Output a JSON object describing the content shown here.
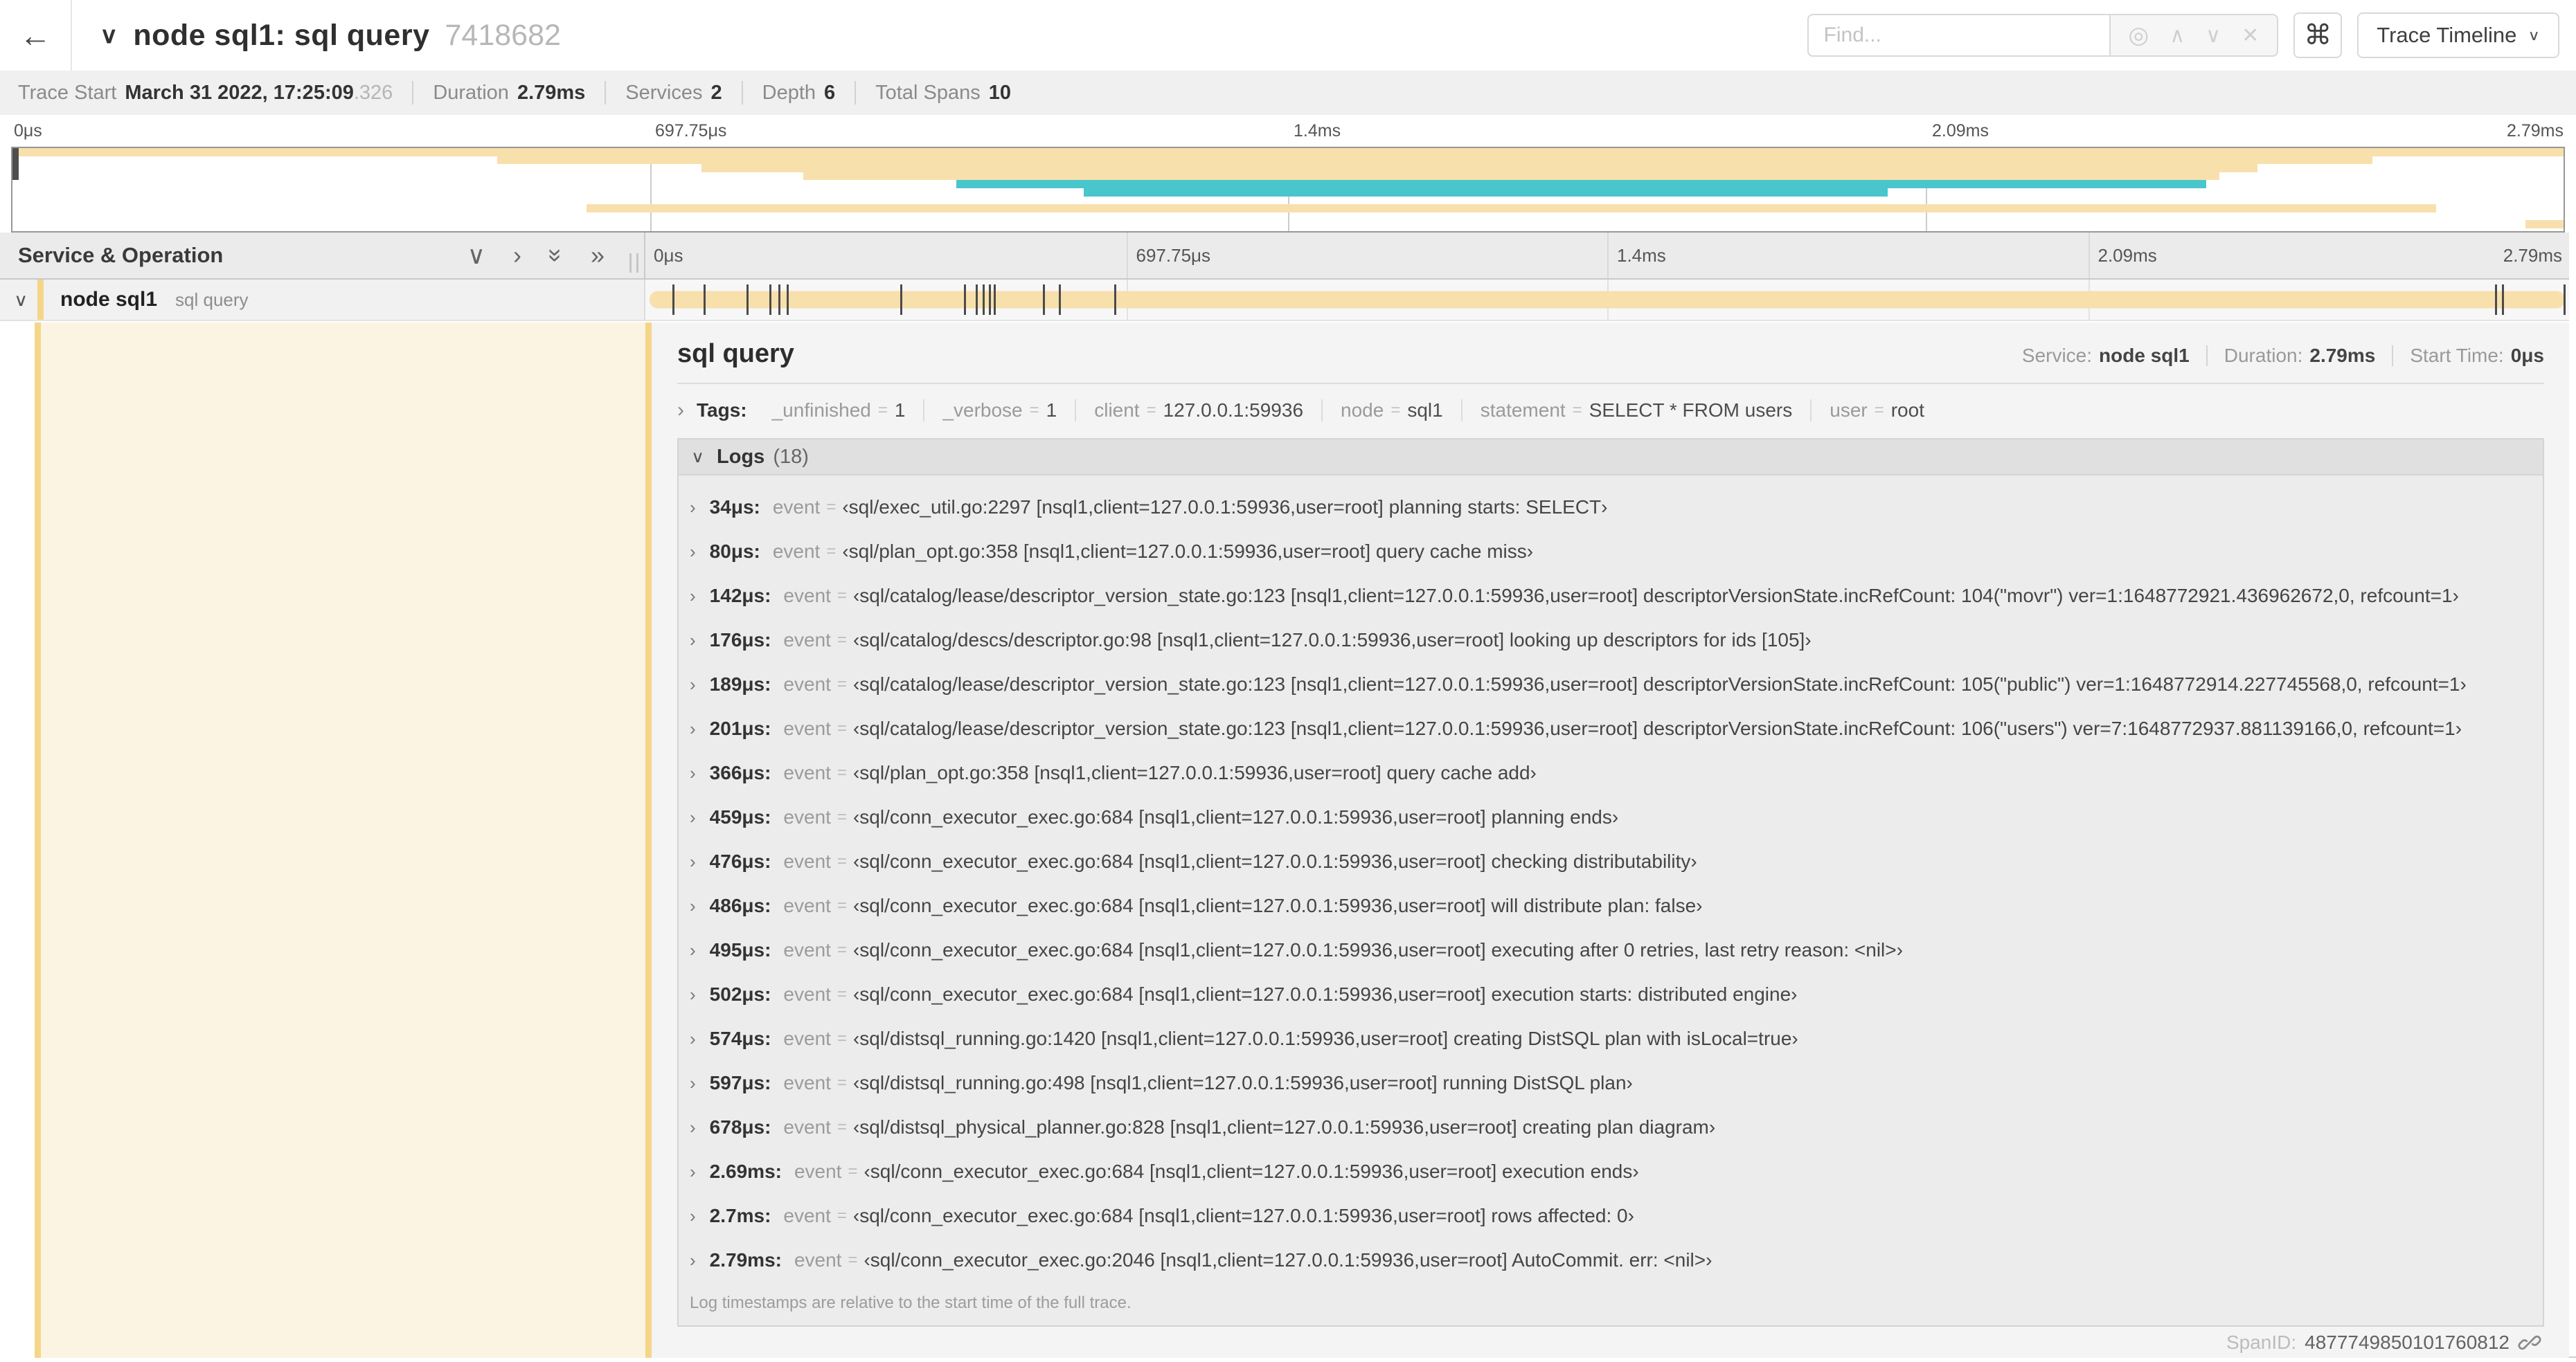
{
  "header": {
    "title": "node sql1: sql query",
    "trace_id": "7418682",
    "find_placeholder": "Find...",
    "view_button": "Trace Timeline",
    "icons": {
      "back": "←",
      "title_chevron": "∨",
      "locate": "◎",
      "prev": "∧",
      "next": "∨",
      "clear": "✕",
      "shortcuts": "⌘",
      "caret": "∨"
    }
  },
  "stats": {
    "trace_start_label": "Trace Start",
    "trace_start_value": "March 31 2022, 17:25:09",
    "trace_start_fraction": ".326",
    "duration_label": "Duration",
    "duration_value": "2.79ms",
    "services_label": "Services",
    "services_value": "2",
    "depth_label": "Depth",
    "depth_value": "6",
    "total_spans_label": "Total Spans",
    "total_spans_value": "10"
  },
  "timeline": {
    "left_header": "Service & Operation",
    "header_icons": {
      "collapse_one": "∨",
      "expand_one": "›",
      "collapse_all": "»",
      "expand_all": "»"
    },
    "ticks": [
      "0μs",
      "697.75μs",
      "1.4ms",
      "2.09ms",
      "2.79ms"
    ],
    "colors": {
      "yellow": "#F7E0AC",
      "teal": "#49C6CB",
      "accent": "#F5D689"
    },
    "minimap_rows": [
      {
        "row": 0,
        "start": 0,
        "end": 100,
        "color": "yellow"
      },
      {
        "row": 1,
        "start": 19,
        "end": 92.5,
        "color": "yellow"
      },
      {
        "row": 2,
        "start": 27,
        "end": 88,
        "color": "yellow"
      },
      {
        "row": 3,
        "start": 31,
        "end": 86.5,
        "color": "yellow"
      },
      {
        "row": 4,
        "start": 37,
        "end": 86,
        "color": "teal"
      },
      {
        "row": 5,
        "start": 42,
        "end": 73.5,
        "color": "teal"
      },
      {
        "row": 7,
        "start": 22.5,
        "end": 95,
        "color": "yellow"
      },
      {
        "row": 9,
        "start": 98.5,
        "end": 100,
        "color": "yellow"
      }
    ],
    "span_row": {
      "service": "node sql1",
      "operation": "sql query",
      "total_us": 2791,
      "log_marks_us": [
        34,
        80,
        142,
        176,
        189,
        201,
        366,
        459,
        476,
        486,
        495,
        502,
        574,
        597,
        678,
        2690,
        2700,
        2790
      ]
    }
  },
  "detail": {
    "title": "sql query",
    "meta": {
      "service_label": "Service:",
      "service": "node sql1",
      "duration_label": "Duration:",
      "duration": "2.79ms",
      "start_label": "Start Time:",
      "start": "0μs"
    },
    "tags_label": "Tags:",
    "tags": [
      {
        "key": "_unfinished",
        "value": "1"
      },
      {
        "key": "_verbose",
        "value": "1"
      },
      {
        "key": "client",
        "value": "127.0.0.1:59936"
      },
      {
        "key": "node",
        "value": "sql1"
      },
      {
        "key": "statement",
        "value": "SELECT * FROM users"
      },
      {
        "key": "user",
        "value": "root"
      }
    ],
    "logs": {
      "title": "Logs",
      "count": "(18)",
      "field": "event",
      "entries": [
        {
          "time": "34μs:",
          "value": "‹sql/exec_util.go:2297 [nsql1,client=127.0.0.1:59936,user=root] planning starts: SELECT›"
        },
        {
          "time": "80μs:",
          "value": "‹sql/plan_opt.go:358 [nsql1,client=127.0.0.1:59936,user=root] query cache miss›"
        },
        {
          "time": "142μs:",
          "value": "‹sql/catalog/lease/descriptor_version_state.go:123 [nsql1,client=127.0.0.1:59936,user=root] descriptorVersionState.incRefCount: 104(\"movr\") ver=1:1648772921.436962672,0, refcount=1›"
        },
        {
          "time": "176μs:",
          "value": "‹sql/catalog/descs/descriptor.go:98 [nsql1,client=127.0.0.1:59936,user=root] looking up descriptors for ids [105]›"
        },
        {
          "time": "189μs:",
          "value": "‹sql/catalog/lease/descriptor_version_state.go:123 [nsql1,client=127.0.0.1:59936,user=root] descriptorVersionState.incRefCount: 105(\"public\") ver=1:1648772914.227745568,0, refcount=1›"
        },
        {
          "time": "201μs:",
          "value": "‹sql/catalog/lease/descriptor_version_state.go:123 [nsql1,client=127.0.0.1:59936,user=root] descriptorVersionState.incRefCount: 106(\"users\") ver=7:1648772937.881139166,0, refcount=1›"
        },
        {
          "time": "366μs:",
          "value": "‹sql/plan_opt.go:358 [nsql1,client=127.0.0.1:59936,user=root] query cache add›"
        },
        {
          "time": "459μs:",
          "value": "‹sql/conn_executor_exec.go:684 [nsql1,client=127.0.0.1:59936,user=root] planning ends›"
        },
        {
          "time": "476μs:",
          "value": "‹sql/conn_executor_exec.go:684 [nsql1,client=127.0.0.1:59936,user=root] checking distributability›"
        },
        {
          "time": "486μs:",
          "value": "‹sql/conn_executor_exec.go:684 [nsql1,client=127.0.0.1:59936,user=root] will distribute plan: false›"
        },
        {
          "time": "495μs:",
          "value": "‹sql/conn_executor_exec.go:684 [nsql1,client=127.0.0.1:59936,user=root] executing after 0 retries, last retry reason: <nil>›"
        },
        {
          "time": "502μs:",
          "value": "‹sql/conn_executor_exec.go:684 [nsql1,client=127.0.0.1:59936,user=root] execution starts: distributed engine›"
        },
        {
          "time": "574μs:",
          "value": "‹sql/distsql_running.go:1420 [nsql1,client=127.0.0.1:59936,user=root] creating DistSQL plan with isLocal=true›"
        },
        {
          "time": "597μs:",
          "value": "‹sql/distsql_running.go:498 [nsql1,client=127.0.0.1:59936,user=root] running DistSQL plan›"
        },
        {
          "time": "678μs:",
          "value": "‹sql/distsql_physical_planner.go:828 [nsql1,client=127.0.0.1:59936,user=root] creating plan diagram›"
        },
        {
          "time": "2.69ms:",
          "value": "‹sql/conn_executor_exec.go:684 [nsql1,client=127.0.0.1:59936,user=root] execution ends›"
        },
        {
          "time": "2.7ms:",
          "value": "‹sql/conn_executor_exec.go:684 [nsql1,client=127.0.0.1:59936,user=root] rows affected: 0›"
        },
        {
          "time": "2.79ms:",
          "value": "‹sql/conn_executor_exec.go:2046 [nsql1,client=127.0.0.1:59936,user=root] AutoCommit. err: <nil>›"
        }
      ],
      "footnote": "Log timestamps are relative to the start time of the full trace."
    },
    "footer": {
      "span_id_label": "SpanID:",
      "span_id": "4877749850101760812"
    }
  }
}
